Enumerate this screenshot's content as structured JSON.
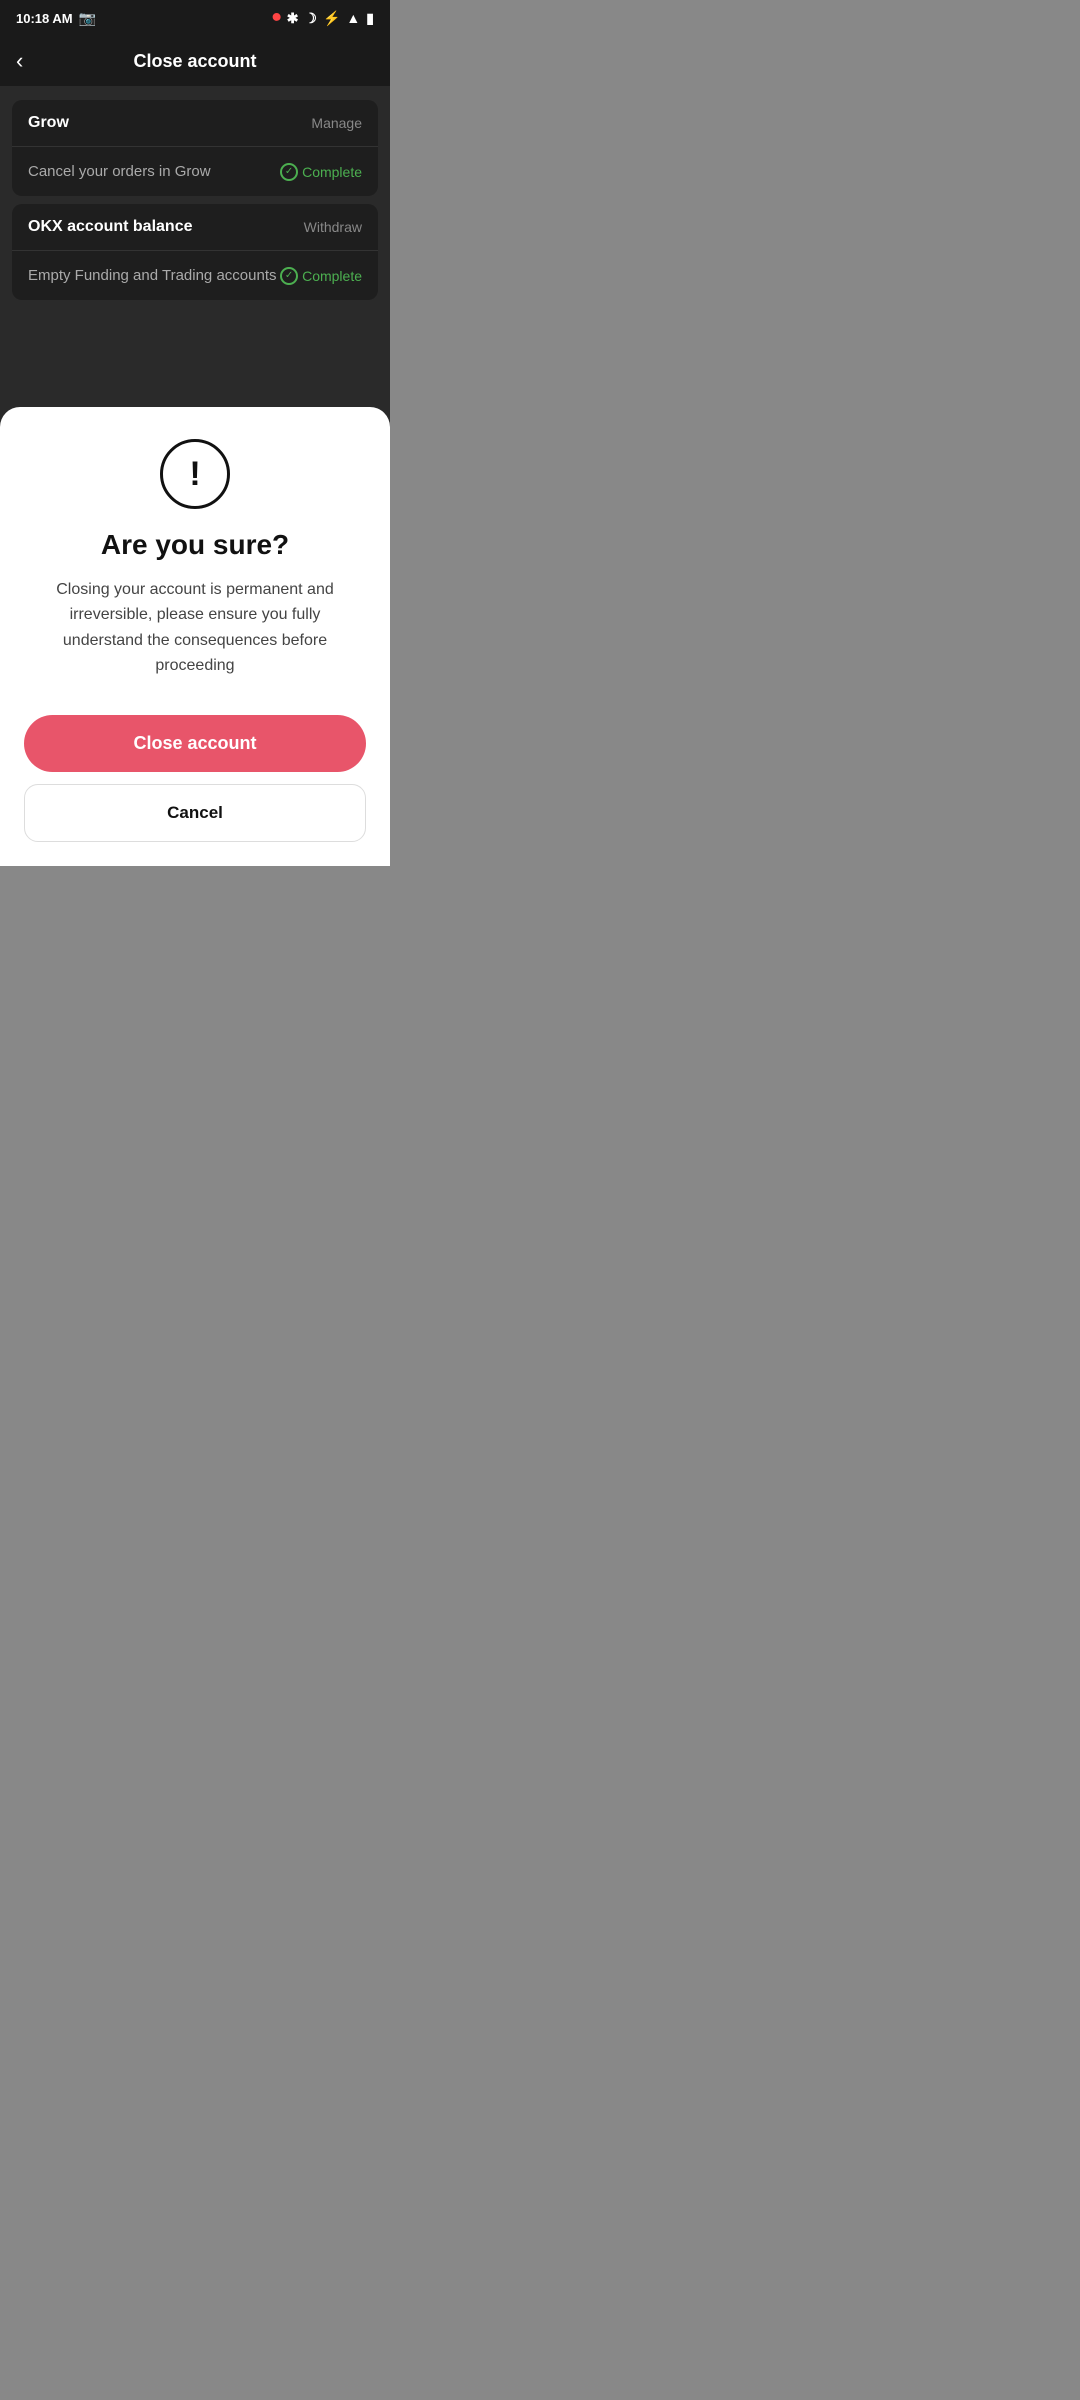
{
  "statusBar": {
    "time": "10:18 AM",
    "icons": [
      "camera",
      "bluetooth",
      "moon",
      "power",
      "wifi",
      "battery"
    ]
  },
  "header": {
    "title": "Close account",
    "backLabel": "‹"
  },
  "sections": [
    {
      "id": "grow",
      "title": "Grow",
      "action": "Manage",
      "rows": [
        {
          "text": "Cancel your orders in Grow",
          "status": "Complete"
        }
      ]
    },
    {
      "id": "okx",
      "title": "OKX account balance",
      "action": "Withdraw",
      "rows": [
        {
          "text": "Empty Funding and Trading accounts",
          "status": "Complete"
        }
      ]
    }
  ],
  "modal": {
    "warningIcon": "!",
    "title": "Are you sure?",
    "description": "Closing your account is permanent and irreversible, please ensure you fully understand the consequences before proceeding",
    "closeAccountLabel": "Close account",
    "cancelLabel": "Cancel"
  },
  "navBar": {
    "back": "‹",
    "home": "□",
    "menu": "≡"
  },
  "colors": {
    "complete": "#4caf50",
    "closeBtn": "#e8556a",
    "headerBg": "#1a1a1a",
    "cardBg": "#1e1e1e"
  }
}
